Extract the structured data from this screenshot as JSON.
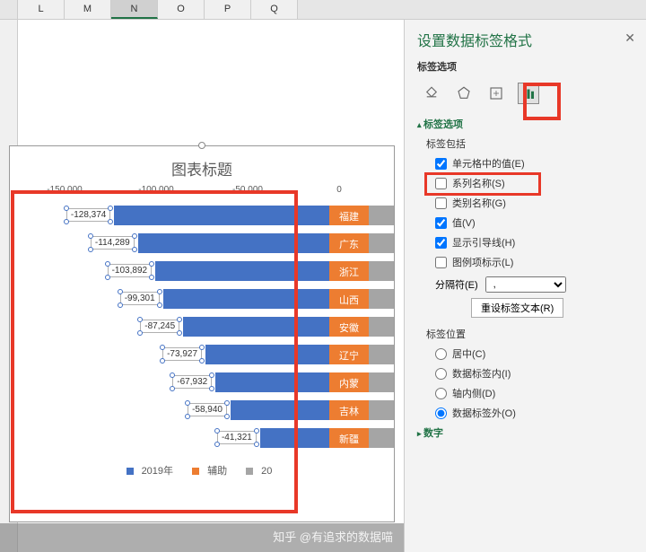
{
  "columns": [
    "L",
    "M",
    "N",
    "O",
    "P",
    "Q"
  ],
  "selected_col": "N",
  "chart": {
    "title": "图表标题",
    "axis_ticks": [
      "-150,000",
      "-100,000",
      "-50,000",
      "0"
    ],
    "legend": [
      {
        "label": "2019年",
        "color": "#4472c4"
      },
      {
        "label": "辅助",
        "color": "#ed7d31"
      },
      {
        "label": "20",
        "color": "#a5a5a5"
      }
    ]
  },
  "chart_data": {
    "type": "bar",
    "orientation": "horizontal",
    "title": "图表标题",
    "xlabel": "",
    "ylabel": "",
    "xlim": [
      -150000,
      50000
    ],
    "categories": [
      "福建",
      "广东",
      "浙江",
      "山西",
      "安徽",
      "辽宁",
      "内蒙",
      "吉林",
      "新疆"
    ],
    "series": [
      {
        "name": "2019年",
        "values": [
          -128374,
          -114289,
          -103892,
          -99301,
          -87245,
          -73927,
          -67932,
          -58940,
          -41321
        ]
      },
      {
        "name": "辅助",
        "values": [
          20000,
          20000,
          20000,
          20000,
          20000,
          20000,
          20000,
          20000,
          20000
        ]
      }
    ],
    "data_labels": [
      "-128,374",
      "-114,289",
      "-103,892",
      "-99,301",
      "-87,245",
      "-73,927",
      "-67,932",
      "-58,940",
      "-41,321"
    ]
  },
  "pane": {
    "title": "设置数据标签格式",
    "subtitle": "标签选项",
    "section_label_options": "标签选项",
    "label_contains": "标签包括",
    "cb_cell_value": "单元格中的值(E)",
    "cb_series_name": "系列名称(S)",
    "cb_category_name": "类别名称(G)",
    "cb_value": "值(V)",
    "cb_leader_lines": "显示引导线(H)",
    "cb_legend_key": "图例项标示(L)",
    "separator_label": "分隔符(E)",
    "separator_value": ",",
    "reset_button": "重设标签文本(R)",
    "position_label": "标签位置",
    "rb_center": "居中(C)",
    "rb_inside_end": "数据标签内(I)",
    "rb_inside_base": "轴内侧(D)",
    "rb_outside_end": "数据标签外(O)",
    "section_number": "数字"
  },
  "watermark": "知乎 @有追求的数据喵"
}
